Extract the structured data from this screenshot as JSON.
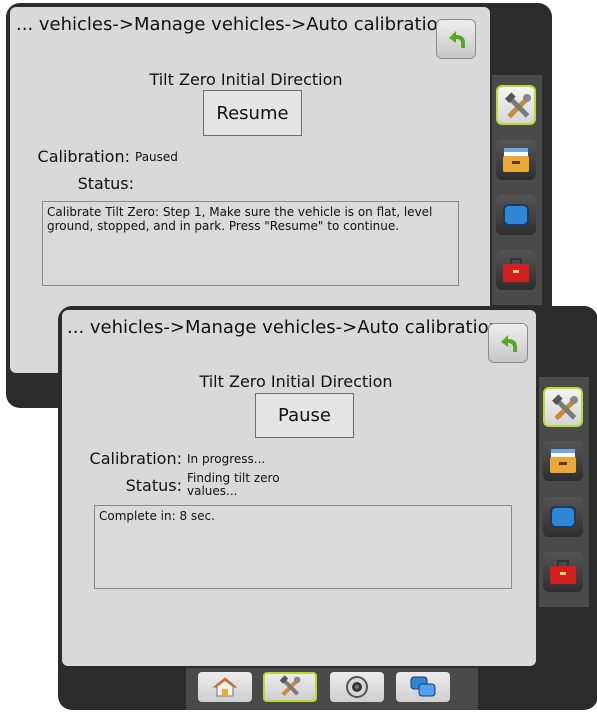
{
  "back_screen": {
    "breadcrumb": "... vehicles->Manage vehicles->Auto calibration",
    "subtitle": "Tilt Zero Initial Direction",
    "action_button": "Resume",
    "calibration_label": "Calibration:",
    "calibration_value": "Paused",
    "status_label": "Status:",
    "status_value": "",
    "message": "Calibrate Tilt Zero: Step 1, Make sure the vehicle is on flat, level ground, stopped, and in park. Press \"Resume\" to continue.",
    "side_icons": [
      "tools-icon",
      "file-cabinet-icon",
      "monitor-icon",
      "toolbox-icon"
    ]
  },
  "front_screen": {
    "breadcrumb": "... vehicles->Manage vehicles->Auto calibration",
    "subtitle": "Tilt Zero Initial Direction",
    "action_button": "Pause",
    "calibration_label": "Calibration:",
    "calibration_value": "In progress...",
    "status_label": "Status:",
    "status_value_line1": "Finding tilt zero",
    "status_value_line2": "values...",
    "message": "Complete in: 8 sec.",
    "side_icons": [
      "tools-icon",
      "file-cabinet-icon",
      "monitor-icon",
      "toolbox-icon"
    ],
    "bottom_tabs": [
      "home-icon",
      "tools-icon",
      "camera-icon",
      "multi-screen-icon"
    ]
  },
  "colors": {
    "frame": "#2c2c2c",
    "panel": "#d9d9d9",
    "active_border": "#b7dc2c",
    "back_arrow": "#5aa52a"
  }
}
